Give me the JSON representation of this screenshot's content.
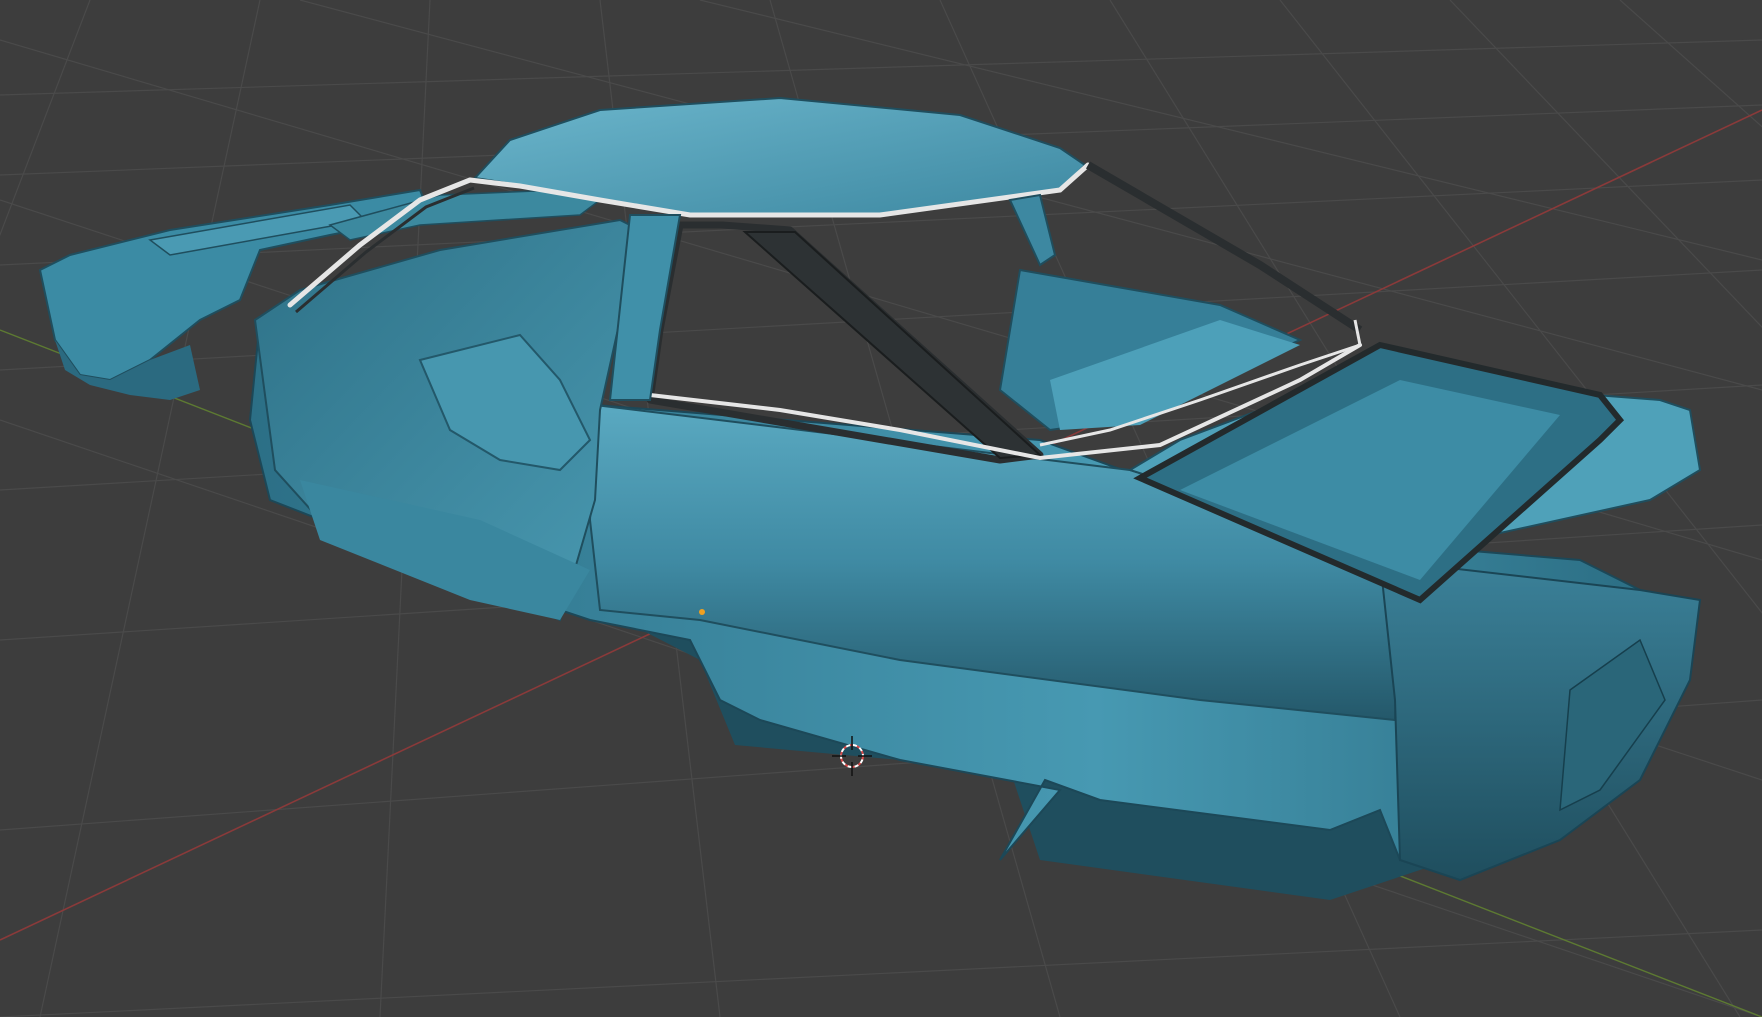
{
  "app": {
    "kind": "3D viewport",
    "view": "perspective",
    "shading": "solid"
  },
  "colors": {
    "background": "#3d3d3d",
    "grid_line": "#4a4a4a",
    "x_axis": "#8a3a3a",
    "y_axis": "#5d7a32",
    "model_body": "#3f8aa3",
    "model_shadow": "#1f4f60",
    "model_highlight": "#6cb6cc",
    "window_trim_dark": "#2a2e30",
    "window_trim_chrome": "#e6e6e6",
    "cursor_red": "#d84a4a",
    "origin_dot": "#f0a020"
  },
  "scene": {
    "object": "car-body-shell",
    "icons": [
      "3d-cursor-icon",
      "object-origin-icon"
    ]
  }
}
